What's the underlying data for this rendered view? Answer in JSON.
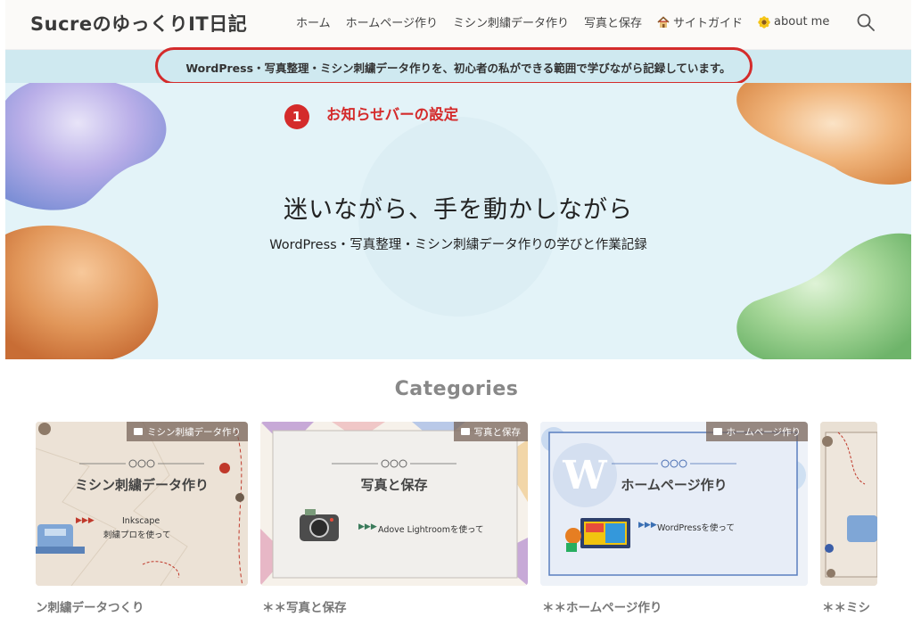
{
  "header": {
    "site_title": "SucreのゆっくりIT日記",
    "nav": [
      {
        "label": "ホーム",
        "icon": ""
      },
      {
        "label": "ホームページ作り",
        "icon": ""
      },
      {
        "label": "ミシン刺繍データ作り",
        "icon": ""
      },
      {
        "label": "写真と保存",
        "icon": ""
      },
      {
        "label": "サイトガイド",
        "icon": "house-icon"
      },
      {
        "label": "about me",
        "icon": "sunflower-icon"
      }
    ],
    "search_icon": "search-icon"
  },
  "notice": {
    "text": "WordPress・写真整理・ミシン刺繍データ作りを、初心者の私ができる範囲で学びながら記録しています。",
    "highlight_color": "#d42b2b"
  },
  "annotation": {
    "number": "1",
    "label": "お知らせバーの設定"
  },
  "hero": {
    "title": "迷いながら、手を動かしながら",
    "subtitle": "WordPress・写真整理・ミシン刺繍データ作りの学びと作業記録"
  },
  "categories": {
    "heading": "Categories",
    "cards": [
      {
        "tag": "ミシン刺繍データ作り",
        "title": "ミシン刺繍データ作り",
        "sub1": "Inkscape",
        "sub2": "刺繍プロを使って",
        "caption": "ン刺繍データつくり"
      },
      {
        "tag": "写真と保存",
        "title": "写真と保存",
        "sub1": "Adove Lightroomを使って",
        "sub2": "",
        "caption": "＊＊写真と保存"
      },
      {
        "tag": "ホームページ作り",
        "title": "ホームページ作り",
        "sub1": "WordPressを使って",
        "sub2": "",
        "caption": "＊＊ホームページ作り"
      },
      {
        "tag": "",
        "title": "",
        "sub1": "",
        "sub2": "",
        "caption": "＊＊ミシ"
      }
    ]
  }
}
